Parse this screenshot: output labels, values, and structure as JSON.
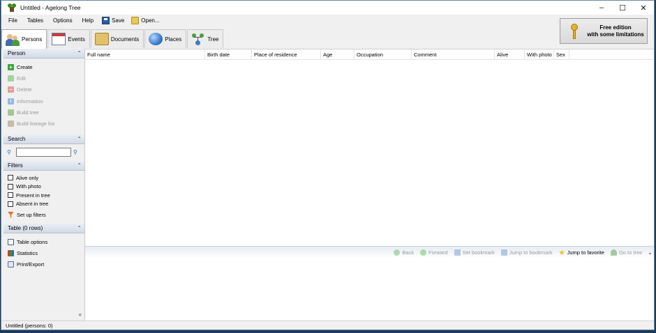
{
  "window": {
    "title": "Untitled - Agelong Tree",
    "controls": [
      "–",
      "☐",
      "✕"
    ]
  },
  "menu": {
    "items": [
      "File",
      "Tables",
      "Options",
      "Help"
    ],
    "save_label": "Save",
    "open_label": "Open..."
  },
  "tabs": [
    {
      "label": "Persons",
      "active": true
    },
    {
      "label": "Events",
      "active": false
    },
    {
      "label": "Documents",
      "active": false
    },
    {
      "label": "Places",
      "active": false
    },
    {
      "label": "Tree",
      "active": false
    }
  ],
  "license": {
    "line1": "Free edition",
    "line2": "with some limitations"
  },
  "sidebar": {
    "person": {
      "header": "Person",
      "actions": [
        {
          "label": "Create",
          "enabled": true
        },
        {
          "label": "Edit",
          "enabled": false
        },
        {
          "label": "Delete",
          "enabled": false
        },
        {
          "label": "Information",
          "enabled": false
        },
        {
          "label": "Build tree",
          "enabled": false
        },
        {
          "label": "Build lineage list",
          "enabled": false
        }
      ]
    },
    "search": {
      "header": "Search",
      "value": ""
    },
    "filters": {
      "header": "Filters",
      "checks": [
        "Alive only",
        "With photo",
        "Present in tree",
        "Absent in tree"
      ],
      "setup_label": "Set up filters"
    },
    "table": {
      "header": "Table (0 rows)",
      "actions": [
        "Table options",
        "Statistics",
        "Print/Export"
      ]
    }
  },
  "grid": {
    "columns": [
      "Full name",
      "Birth date",
      "Place of residence",
      "Age",
      "Occupation",
      "Comment",
      "Alive",
      "With photo",
      "Sex"
    ],
    "rows": []
  },
  "navbar": {
    "buttons": [
      {
        "label": "Back",
        "enabled": false
      },
      {
        "label": "Forward",
        "enabled": false
      },
      {
        "label": "Set bookmark",
        "enabled": false
      },
      {
        "label": "Jump to bookmark",
        "enabled": false
      },
      {
        "label": "Jump to favorite",
        "enabled": true
      },
      {
        "label": "Go to tree",
        "enabled": false
      }
    ]
  },
  "status": {
    "text": "Untitled (persons: 0)"
  }
}
